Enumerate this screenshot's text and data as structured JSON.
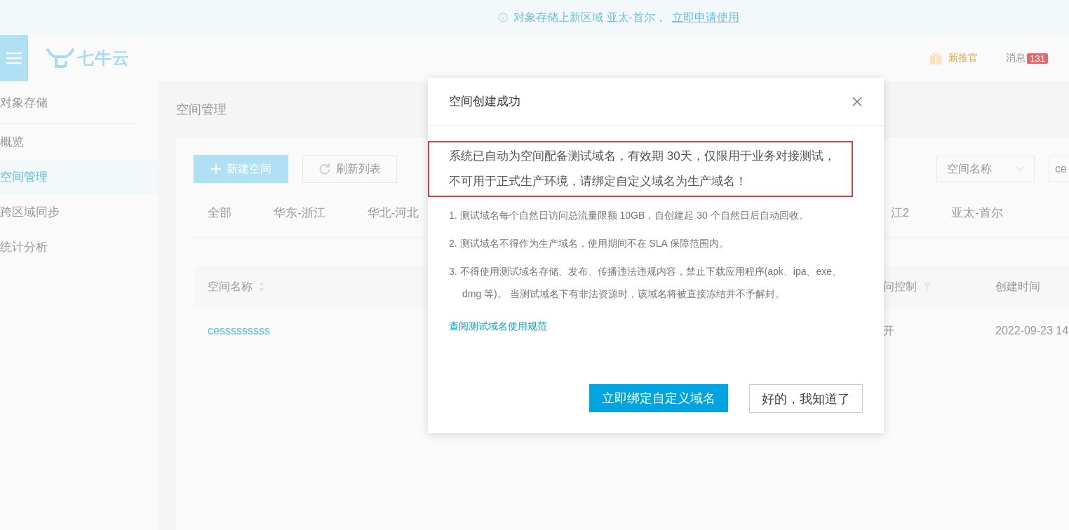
{
  "banner": {
    "text": "对象存储上新区域 亚太-首尔，",
    "link": "立即申请使用"
  },
  "header": {
    "logo": "七牛云",
    "promo": "新推官",
    "messages": {
      "label": "消息",
      "count": "131"
    }
  },
  "sidebar": {
    "title": "对象存储",
    "items": [
      {
        "label": "概览",
        "selected": false
      },
      {
        "label": "空间管理",
        "selected": true
      },
      {
        "label": "跨区域同步",
        "selected": false
      },
      {
        "label": "统计分析",
        "selected": false
      }
    ]
  },
  "page": {
    "title": "空间管理",
    "new_button": "新建空间",
    "refresh_button": "刷新列表",
    "search": {
      "field": "空间名称",
      "value": "ce"
    },
    "region_tabs": [
      {
        "label": "全部"
      },
      {
        "label": "华东-浙江"
      },
      {
        "label": "华北-河北"
      },
      {
        "label": "江2"
      },
      {
        "label": "亚太-首尔"
      }
    ],
    "table": {
      "columns": [
        {
          "label": "空间名称",
          "kind": "sort"
        },
        {
          "label": "问控制",
          "kind": "filter"
        },
        {
          "label": "创建时间",
          "kind": "plain"
        }
      ],
      "rows": [
        {
          "name": "cesssssssss",
          "access": "开",
          "created": "2022-09-23 14"
        }
      ]
    }
  },
  "dialog": {
    "title": "空间创建成功",
    "highlight": "系统已自动为空间配备测试域名，有效期 30天，仅限用于业务对接测试，不可用于正式生产环境，请绑定自定义域名为生产域名！",
    "notes": [
      "1. 测试域名每个自然日访问总流量限额  10GB，自创建起  30  个自然日后自动回收。",
      "2. 测试域名不得作为生产域名，使用期间不在 SLA 保障范围内。",
      "3. 不得使用测试域名存储、发布、传播违法违规内容，禁止下载应用程序(apk、ipa、exe、dmg 等)。 当测试域名下有非法资源时，该域名将被直接冻结并不予解封。"
    ],
    "link": "查阅测试域名使用规范",
    "primary_button": "立即绑定自定义域名",
    "secondary_button": "好的，我知道了"
  }
}
